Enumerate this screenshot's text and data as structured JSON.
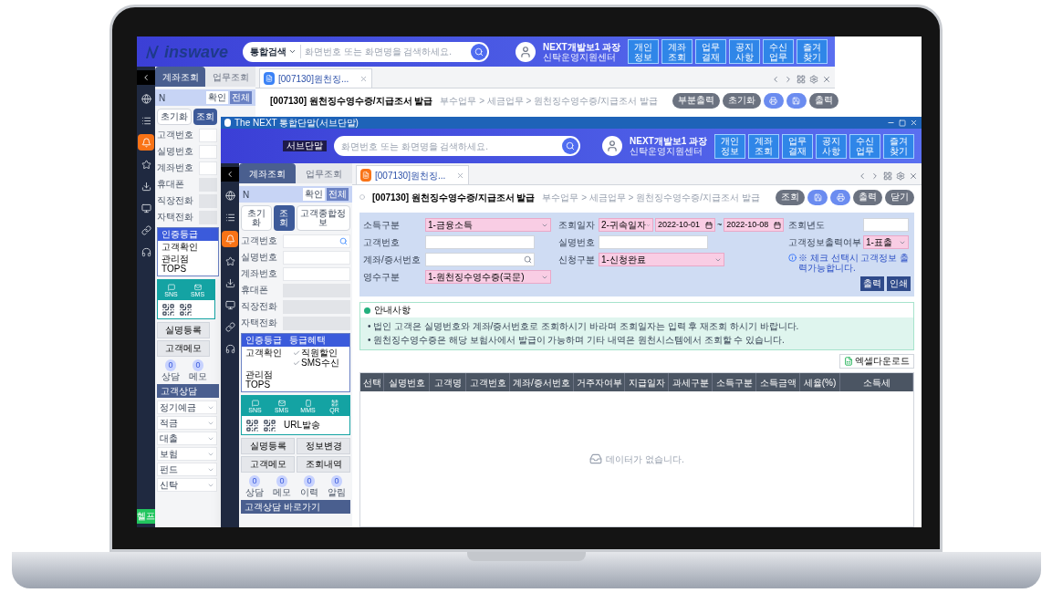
{
  "back_window": {
    "logo": "inswave",
    "header": {
      "scope": "통합검색",
      "placeholder": "화면번호 또는 화면명을 검색하세요.",
      "user_name": "NEXT개발보1 과장",
      "user_dept": "신탁운영지원센터",
      "quick_menus": [
        "개인 정보",
        "계좌 조회",
        "업무 결재",
        "공지 사항",
        "수신 업무",
        "즐겨 찾기"
      ]
    },
    "rail": [
      {
        "selected": false
      },
      {
        "selected": false
      },
      {
        "selected": true
      },
      {
        "selected": false
      },
      {
        "selected": false
      },
      {
        "selected": false
      },
      {
        "selected": false
      },
      {
        "selected": false
      }
    ],
    "help_button": "헬프",
    "side": {
      "tabs": [
        {
          "label": "계좌조회",
          "selected": true
        },
        {
          "label": "업무조회",
          "selected": false
        }
      ],
      "search": {
        "value": "N",
        "buttons": [
          {
            "label": "확인",
            "selected": false
          },
          {
            "label": "전체",
            "selected": true
          }
        ]
      },
      "actions": [
        {
          "label": "초기화",
          "selected": false
        },
        {
          "label": "조회",
          "selected": true
        }
      ],
      "fields": [
        {
          "label": "고객번호",
          "disabled": false
        },
        {
          "label": "실명번호",
          "disabled": false
        },
        {
          "label": "계좌번호",
          "disabled": false
        },
        {
          "label": "휴대폰",
          "disabled": true
        },
        {
          "label": "직장전화",
          "disabled": true
        },
        {
          "label": "자택전화",
          "disabled": true
        }
      ],
      "grade": {
        "header": "인증등급",
        "grade": "고객확인",
        "branch_label": "관리점",
        "branch": "TOPS"
      },
      "contact": [
        "SNS",
        "SMS"
      ],
      "buttons": [
        "실명등록",
        "고객메모"
      ],
      "counters": [
        {
          "value": "0",
          "label": "상담"
        },
        {
          "value": "0",
          "label": "메모"
        }
      ],
      "section": "고객상담",
      "consult_items": [
        "정기예금",
        "적금",
        "대출",
        "보험",
        "펀드",
        "신탁"
      ]
    },
    "main": {
      "tab": {
        "label": "[007130]원천징...",
        "selected": true
      },
      "title": "[007130] 원천징수영수증/지급조서 발급",
      "breadcrumb": "부수업무 > 세금업무 > 원천징수영수증/지급조서 발급",
      "actions": [
        {
          "kind": "text",
          "label": "부분출력"
        },
        {
          "kind": "text",
          "label": "초기화"
        },
        {
          "kind": "icon"
        },
        {
          "kind": "icon"
        },
        {
          "kind": "text",
          "label": "출력"
        }
      ]
    }
  },
  "front_window": {
    "title": "The NEXT 통합단말(서브단말)",
    "badge": "서브단말",
    "header": {
      "placeholder": "화면번호 또는 화면명을 검색하세요.",
      "user_name": "NEXT개발보1 과장",
      "user_dept": "신탁운영지원센터",
      "quick_menus": [
        "개인 정보",
        "계좌 조회",
        "업무 결재",
        "공지 사항",
        "수신 업무",
        "즐겨 찾기"
      ]
    },
    "rail": [
      {
        "selected": false
      },
      {
        "selected": false
      },
      {
        "selected": true
      },
      {
        "selected": false
      },
      {
        "selected": false
      },
      {
        "selected": false
      },
      {
        "selected": false
      },
      {
        "selected": false
      }
    ],
    "side": {
      "tabs": [
        {
          "label": "계좌조회",
          "selected": true
        },
        {
          "label": "업무조회",
          "selected": false
        }
      ],
      "search": {
        "value": "N",
        "buttons": [
          {
            "label": "확인",
            "selected": false
          },
          {
            "label": "전체",
            "selected": true
          }
        ]
      },
      "actions": [
        {
          "label": "초기화",
          "selected": false
        },
        {
          "label": "조회",
          "selected": true
        },
        {
          "label": "고객종합정보",
          "selected": false
        }
      ],
      "fields": [
        {
          "label": "고객번호",
          "disabled": false,
          "search": true
        },
        {
          "label": "실명번호",
          "disabled": false
        },
        {
          "label": "계좌번호",
          "disabled": false
        },
        {
          "label": "휴대폰",
          "disabled": true
        },
        {
          "label": "직장전화",
          "disabled": true
        },
        {
          "label": "자택전화",
          "disabled": true
        }
      ],
      "grade": {
        "header": "인증등급",
        "benefit": "등급혜택",
        "grade": "고객확인",
        "perks": [
          "직원할인",
          "SMS수신"
        ],
        "branch_label": "관리점",
        "branch": "TOPS"
      },
      "contact": [
        "SNS",
        "SMS",
        "MMS",
        "QR"
      ],
      "url_label": "URL발송",
      "buttons": [
        "실명등록",
        "정보변경",
        "고객메모",
        "조회내역"
      ],
      "counters": [
        {
          "value": "0",
          "label": "상담"
        },
        {
          "value": "0",
          "label": "메모"
        },
        {
          "value": "0",
          "label": "이력"
        },
        {
          "value": "0",
          "label": "알림"
        }
      ],
      "section": "고객상담 바로가기"
    },
    "main": {
      "tab": {
        "label": "[007130]원천징...",
        "selected": true
      },
      "title": "[007130] 원천징수영수증/지급조서 발급",
      "breadcrumb": "부수업무 > 세금업무 > 원천징수영수증/지급조서 발급",
      "actions": [
        {
          "kind": "text",
          "label": "조회"
        },
        {
          "kind": "icon"
        },
        {
          "kind": "icon"
        },
        {
          "kind": "text",
          "label": "출력"
        },
        {
          "kind": "text",
          "label": "닫기"
        }
      ],
      "form": {
        "columns": [
          {
            "fields": [
              {
                "kind": "select",
                "label": "소득구분",
                "value": "1-금융소득",
                "required": true
              },
              {
                "kind": "input",
                "label": "고객번호"
              },
              {
                "kind": "search",
                "label": "계좌/증서번호"
              },
              {
                "kind": "select",
                "label": "영수구분",
                "value": "1-원천징수영수증(국문)",
                "required": true
              }
            ]
          },
          {
            "fields": [
              {
                "kind": "date_range",
                "label": "조회일자",
                "value": "2-귀속일자",
                "required": true,
                "from": "2022-10-01",
                "separator": "~",
                "to": "2022-10-08"
              },
              {
                "kind": "input",
                "label": "실명번호"
              },
              {
                "kind": "select",
                "label": "신청구분",
                "value": "1-신청완료",
                "required": true
              }
            ]
          },
          {
            "fields": [
              {
                "kind": "input",
                "label": "조회년도"
              },
              {
                "kind": "select",
                "label": "고객정보출력여부",
                "value": "1-표출",
                "required": true
              },
              {
                "kind": "note",
                "text": "※ 체크 선택시 고객정보 출력가능합니다."
              }
            ]
          }
        ],
        "buttons": [
          "출력",
          "인쇄"
        ]
      },
      "notice": {
        "title": "안내사항",
        "lines": [
          "• 법인 고객은 실명번호와 계좌/증서번호로 조회하시기 바라며 조회일자는 입력 후 재조회 하시기 바랍니다.",
          "• 원천징수영수증은 해당 보험사에서 발급이 가능하며 기타 내역은 원천시스템에서 조회할 수 있습니다."
        ]
      },
      "excel_button": "엑셀다운로드",
      "table": {
        "columns": [
          "선택",
          "실명번호",
          "고객명",
          "고객번호",
          "계좌/증서번호",
          "거주자여부",
          "지급일자",
          "과세구분",
          "소득구분",
          "소득금액",
          "세율(%)",
          "소득세"
        ],
        "empty": "데이터가 없습니다."
      }
    }
  }
}
